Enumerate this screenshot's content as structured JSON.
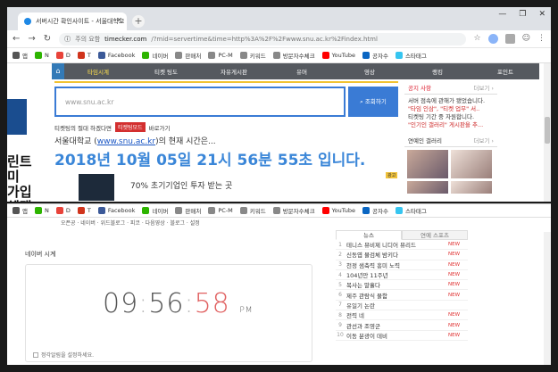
{
  "browser": {
    "tab_title": "서버시간 확인사이트 - 서울대학교",
    "new_tab": "+",
    "url_scheme": "주의 요함",
    "url_domain": "timecker.com",
    "url_path": "/?mid=servertime&time=http%3A%2F%2Fwww.snu.ac.kr%2Findex.html",
    "bookmarks": [
      {
        "icon": "apps-icon",
        "label": "앱",
        "color": "#555555"
      },
      {
        "icon": "naver-icon",
        "label": "N",
        "color": "#2db400"
      },
      {
        "icon": "daum-icon",
        "label": "D",
        "color": "#e8433a"
      },
      {
        "icon": "t-icon",
        "label": "T",
        "color": "#d0341c"
      },
      {
        "icon": "facebook-icon",
        "label": "Facebook",
        "color": "#3b5998"
      },
      {
        "icon": "naver2-icon",
        "label": "네이버",
        "color": "#2db400"
      },
      {
        "icon": "doc-icon",
        "label": "판매처",
        "color": "#888888"
      },
      {
        "icon": "doc-icon",
        "label": "PC-M",
        "color": "#888888"
      },
      {
        "icon": "doc-icon",
        "label": "키워드",
        "color": "#888888"
      },
      {
        "icon": "doc-icon",
        "label": "방문자수체크",
        "color": "#888888"
      },
      {
        "icon": "youtube-icon",
        "label": "YouTube",
        "color": "#ff0000"
      },
      {
        "icon": "linkedin-icon",
        "label": "공자수",
        "color": "#0a66c2"
      },
      {
        "icon": "slack-icon",
        "label": "스타태그",
        "color": "#36c5f0"
      }
    ]
  },
  "page1": {
    "menu": [
      "타임시계",
      "티켓 팅도",
      "자유게시판",
      "유머",
      "영상",
      "랭킹",
      "포인트"
    ],
    "search_placeholder": "www.snu.ac.kr",
    "search_button": "조회하기",
    "link_text": "티켓팅의 절대 하겠다면",
    "link_badge": "티켓팅모드",
    "link_suffix": "바로가기",
    "current_prefix": "서울대학교 (",
    "current_link": "www.snu.ac.kr",
    "current_suffix": ")의 현재 시간은...",
    "big_time": "2018년 10월 05일 21시 56분 55초 입니다.",
    "promo_text": "70% 초기기업인 투자 받는 곳",
    "ad_label": "광고",
    "left_ad_text": "린트미\n가입\n혜택",
    "notice_title": "공지 사항",
    "notice_more": "더보기 ›",
    "notice_lines": [
      "서버 점속에 관해가 됐었습니다.",
      "\"타임 인삼\", \"티켓 업무\" 서..",
      "티켓팅 기간 중 자원합니다.",
      "\"인기인 갤러리\" 게시판을 추..."
    ],
    "gallery_title": "연예인 갤러리",
    "gallery_more": "더보기 ›"
  },
  "page2": {
    "subnav": "오픈공 · 네이버 · 위드블로그 · 피코 · 다음영상 · 블로그 · 설정",
    "clock_title": "네이버 시계",
    "clock": {
      "hh": "09",
      "mm": "56",
      "ss": "58",
      "ampm": "PM"
    },
    "alarm_label": "정각알림을 설정하세요.",
    "rank_tabs": [
      "뉴스",
      "연예 스포츠"
    ],
    "rank": [
      {
        "n": "1",
        "kw": "테니스 뮤비제 니디어 뮤리드",
        "new": "NEW"
      },
      {
        "n": "2",
        "kw": "신동엽 뮬검체 밤키다",
        "new": "NEW"
      },
      {
        "n": "3",
        "kw": "천정 샘축력 흥미 노력",
        "new": "NEW"
      },
      {
        "n": "4",
        "kw": "104년만 11주년",
        "new": "NEW"
      },
      {
        "n": "5",
        "kw": "복사는 말흘다",
        "new": "NEW"
      },
      {
        "n": "6",
        "kw": "제주 관람식 물함",
        "new": "NEW"
      },
      {
        "n": "7",
        "kw": "유일기 논란",
        "new": ""
      },
      {
        "n": "8",
        "kw": "전력 네",
        "new": "NEW"
      },
      {
        "n": "9",
        "kw": "관선과 조영군",
        "new": "NEW"
      },
      {
        "n": "10",
        "kw": "이동 분광이 데비",
        "new": "NEW"
      }
    ]
  }
}
